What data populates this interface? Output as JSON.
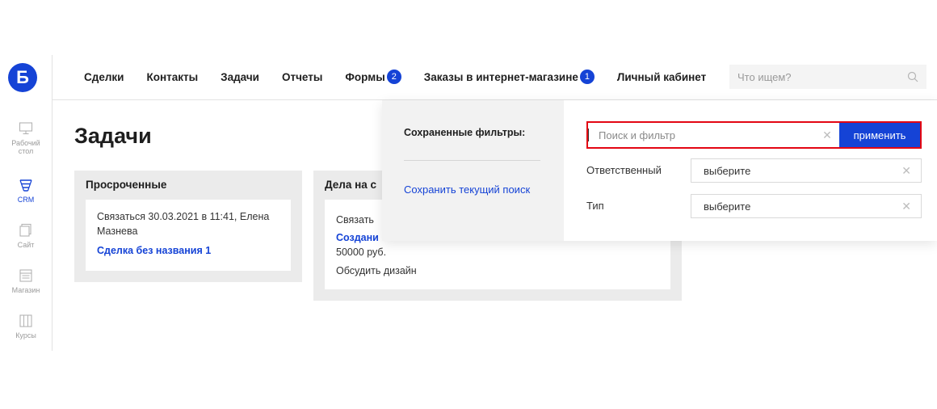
{
  "logo": {
    "letter": "Б"
  },
  "nav": {
    "items": [
      {
        "label": "Сделки"
      },
      {
        "label": "Контакты"
      },
      {
        "label": "Задачи"
      },
      {
        "label": "Отчеты"
      },
      {
        "label": "Формы",
        "badge": "2"
      },
      {
        "label": "Заказы в интернет-магазине",
        "badge": "1"
      },
      {
        "label": "Личный кабинет"
      }
    ],
    "search_placeholder": "Что ищем?"
  },
  "sidebar": {
    "items": [
      {
        "label_line1": "Рабочий",
        "label_line2": "стол",
        "icon": "monitor-icon"
      },
      {
        "label_line1": "CRM",
        "label_line2": "",
        "icon": "crm-icon",
        "active": true
      },
      {
        "label_line1": "Сайт",
        "label_line2": "",
        "icon": "site-icon"
      },
      {
        "label_line1": "Магазин",
        "label_line2": "",
        "icon": "shop-icon"
      },
      {
        "label_line1": "Курсы",
        "label_line2": "",
        "icon": "courses-icon"
      }
    ]
  },
  "page": {
    "title": "Задачи"
  },
  "columns": {
    "overdue": {
      "title": "Просроченные",
      "card": {
        "text": "Связаться 30.03.2021 в 11:41, Елена Мазнева",
        "link": "Сделка без названия 1"
      }
    },
    "today": {
      "title": "Дела на с",
      "card": {
        "text": "Связать",
        "link": "Создани",
        "amount": "50000 руб.",
        "note": "Обсудить дизайн"
      }
    }
  },
  "filter_panel": {
    "saved_title": "Сохраненные фильтры:",
    "save_current": "Сохранить текущий поиск",
    "search_placeholder": "Поиск и фильтр",
    "apply_label": "применить",
    "fields": [
      {
        "label": "Ответственный",
        "value": "выберите"
      },
      {
        "label": "Тип",
        "value": "выберите"
      }
    ]
  },
  "colors": {
    "accent": "#1543d6",
    "highlight": "#e30613"
  }
}
